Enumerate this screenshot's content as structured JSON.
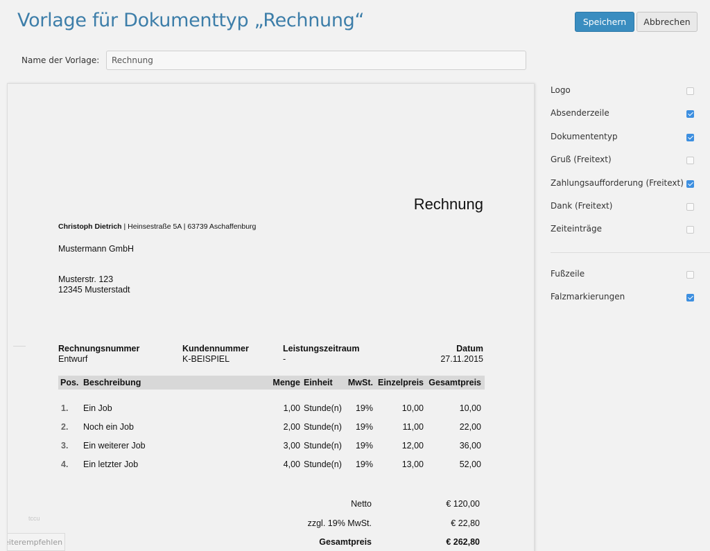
{
  "header": {
    "title": "Vorlage für Dokumenttyp „Rechnung“",
    "save_label": "Speichern",
    "cancel_label": "Abbrechen"
  },
  "template_name": {
    "label": "Name der Vorlage:",
    "value": "Rechnung"
  },
  "document": {
    "doc_type": "Rechnung",
    "sender_name": "Christoph Dietrich",
    "sender_address": " | Heinsestraße 5A | 63739 Aschaffenburg",
    "recipient_name": "Mustermann GmbH",
    "recipient_street": "Musterstr. 123",
    "recipient_city": "12345 Musterstadt",
    "meta": {
      "invoice_no_label": "Rechnungsnummer",
      "invoice_no_value": "Entwurf",
      "customer_no_label": "Kundennummer",
      "customer_no_value": "K-BEISPIEL",
      "period_label": "Leistungszeitraum",
      "period_value": "-",
      "date_label": "Datum",
      "date_value": "27.11.2015"
    },
    "table": {
      "headers": [
        "Pos.",
        "Beschreibung",
        "Menge",
        "Einheit",
        "MwSt.",
        "Einzelpreis",
        "Gesamtpreis"
      ],
      "rows": [
        {
          "pos": "1.",
          "desc": "Ein Job",
          "qty": "1,00",
          "unit": "Stunde(n)",
          "vat": "19%",
          "unit_price": "10,00",
          "total": "10,00"
        },
        {
          "pos": "2.",
          "desc": "Noch ein Job",
          "qty": "2,00",
          "unit": "Stunde(n)",
          "vat": "19%",
          "unit_price": "11,00",
          "total": "22,00"
        },
        {
          "pos": "3.",
          "desc": "Ein weiterer Job",
          "qty": "3,00",
          "unit": "Stunde(n)",
          "vat": "19%",
          "unit_price": "12,00",
          "total": "36,00"
        },
        {
          "pos": "4.",
          "desc": "Ein letzter Job",
          "qty": "4,00",
          "unit": "Stunde(n)",
          "vat": "19%",
          "unit_price": "13,00",
          "total": "52,00"
        }
      ]
    },
    "totals": {
      "net_label": "Netto",
      "net_value": "€ 120,00",
      "vat_label": "zzgl. 19% MwSt.",
      "vat_value": "€ 22,80",
      "gross_label": "Gesamtpreis",
      "gross_value": "€ 262,80"
    },
    "watermark": "tccu",
    "recommend_label": "eiterempfehlen"
  },
  "options": [
    {
      "label": "Logo",
      "checked": false
    },
    {
      "label": "Absenderzeile",
      "checked": true
    },
    {
      "label": "Dokumententyp",
      "checked": true
    },
    {
      "label": "Gruß (Freitext)",
      "checked": false
    },
    {
      "label": "Zahlungsaufforderung (Freitext)",
      "checked": true
    },
    {
      "label": "Dank (Freitext)",
      "checked": false
    },
    {
      "label": "Zeiteinträge",
      "checked": false
    },
    {
      "label": "Fußzeile",
      "checked": false
    },
    {
      "label": "Falzmarkierungen",
      "checked": true
    }
  ],
  "colors": {
    "accent": "#3a8dc0",
    "title": "#3d7ea9",
    "checkbox": "#3d8fe0"
  }
}
